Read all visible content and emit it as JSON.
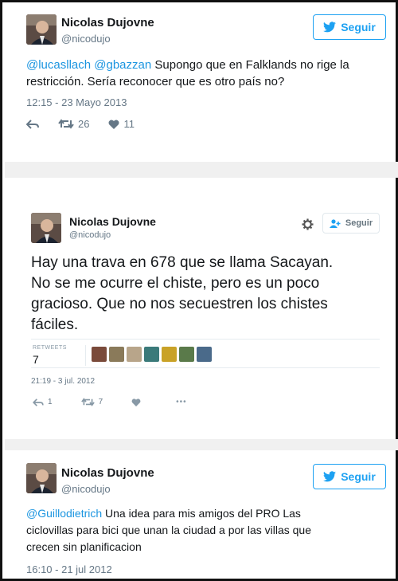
{
  "tweet1": {
    "name": "Nicolas Dujovne",
    "handle": "@nicodujo",
    "follow_label": "Seguir",
    "mention1": "@lucasllach",
    "mention2": "@gbazzan",
    "body_rest": " Supongo que en Falklands no rige la",
    "body_line2": "restricción. Sería reconocer que es otro país no?",
    "date": "12:15 - 23 Mayo 2013",
    "retweets": "26",
    "likes": "11"
  },
  "tweet2": {
    "name": "Nicolas Dujovne",
    "handle": "@nicodujo",
    "follow_label": "Seguir",
    "line1": "Hay una trava en 678 que se llama Sacayan.",
    "line2": "No se me ocurre el chiste, pero es un poco",
    "line3": "gracioso. Que no nos secuestren los chistes",
    "line4": "fáciles.",
    "retweets_label": "RETWEETS",
    "retweets_count": "7",
    "date": "21:19 - 3 jul. 2012",
    "reply_count": "1",
    "retweet_count": "7",
    "more": "•••",
    "retweeter_colors": [
      "#7a4a3a",
      "#8a7a5a",
      "#b8a58a",
      "#3b7a7a",
      "#c9a227",
      "#5a7a4a",
      "#4a6a8a"
    ]
  },
  "tweet3": {
    "name": "Nicolas Dujovne",
    "handle": "@nicodujo",
    "follow_label": "Seguir",
    "mention": "@Guillodietrich",
    "body_rest": " Una idea para mis amigos del PRO Las",
    "body_line2": "ciclovillas para bici que unan la ciudad a por las villas que",
    "body_line3": "crecen sin planificacion",
    "date": "16:10 - 21 jul 2012"
  },
  "colors": {
    "accent": "#1da1f2",
    "mention": "#1b95e0",
    "muted": "#657786"
  }
}
